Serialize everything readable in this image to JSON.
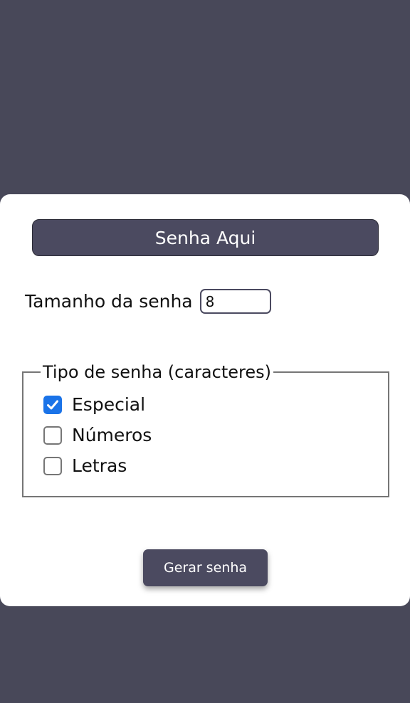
{
  "colors": {
    "page_background": "#484859",
    "card_background": "#ffffff",
    "primary_dark": "#4b4a60",
    "checkbox_checked": "#1a73e8",
    "border_gray": "#767676"
  },
  "password_display": {
    "text": "Senha Aqui"
  },
  "length": {
    "label": "Tamanho da senha",
    "value": "8"
  },
  "character_types": {
    "legend": "Tipo de senha (caracteres)",
    "options": [
      {
        "label": "Especial",
        "checked": true
      },
      {
        "label": "Números",
        "checked": false
      },
      {
        "label": "Letras",
        "checked": false
      }
    ]
  },
  "generate_button": {
    "label": "Gerar senha"
  }
}
